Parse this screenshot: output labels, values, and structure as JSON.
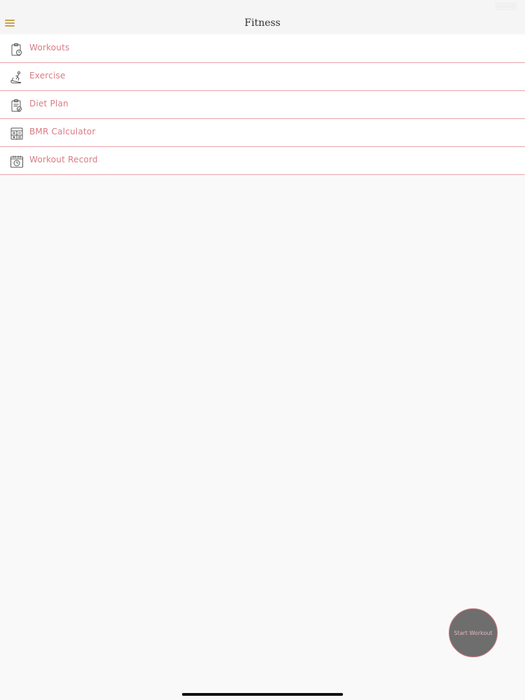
{
  "status_bar": {
    "left_text": "",
    "battery_percent_text": ""
  },
  "nav": {
    "title": "Fitness",
    "menu_icon": "hamburger-icon"
  },
  "menu": {
    "items": [
      {
        "label": "Workouts",
        "icon": "clipboard-timer-icon"
      },
      {
        "label": "Exercise",
        "icon": "treadmill-icon"
      },
      {
        "label": "Diet Plan",
        "icon": "clipboard-check-icon"
      },
      {
        "label": "BMR Calculator",
        "icon": "calculator-icon"
      },
      {
        "label": "Workout Record",
        "icon": "calendar-clock-icon"
      }
    ]
  },
  "fab": {
    "label": "Start Workout"
  },
  "colors": {
    "accent": "#d97b83",
    "divider": "#e6a3ab",
    "menu_icon": "#c9a24e",
    "fab_fill": "#6e6e6e",
    "background": "#faf9fa"
  }
}
